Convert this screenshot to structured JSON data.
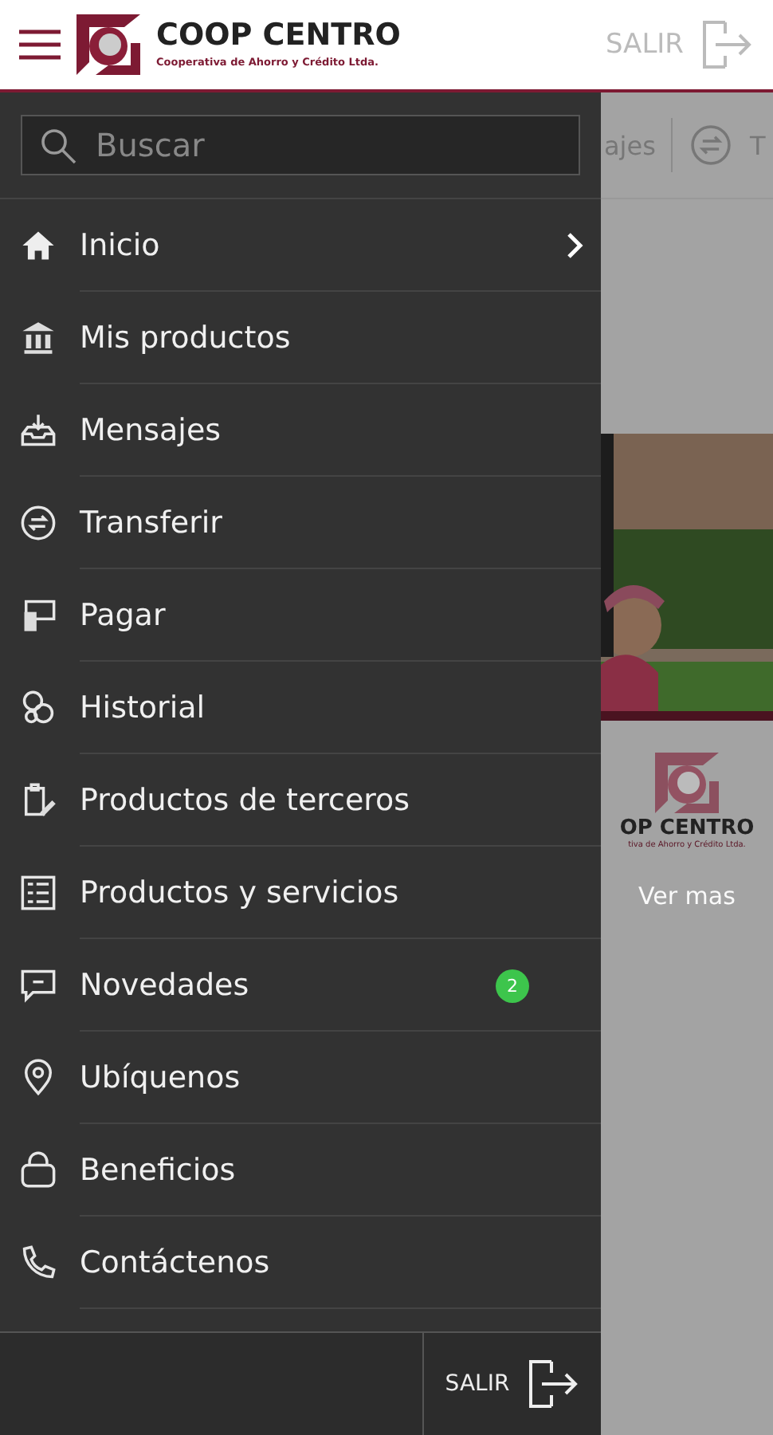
{
  "header": {
    "logo_title": "COOP CENTRO",
    "logo_subtitle": "Cooperativa de Ahorro y Crédito Ltda.",
    "logout": "SALIR"
  },
  "search": {
    "placeholder": "Buscar"
  },
  "menu": [
    {
      "label": "Inicio",
      "chevron": true
    },
    {
      "label": "Mis productos"
    },
    {
      "label": "Mensajes"
    },
    {
      "label": "Transferir"
    },
    {
      "label": "Pagar"
    },
    {
      "label": "Historial"
    },
    {
      "label": "Productos de terceros"
    },
    {
      "label": "Productos y servicios"
    },
    {
      "label": "Novedades",
      "badge": "2"
    },
    {
      "label": "Ubíquenos"
    },
    {
      "label": "Beneficios"
    },
    {
      "label": "Contáctenos"
    }
  ],
  "footer": {
    "logout": "SALIR"
  },
  "background": {
    "tabs": [
      "ajes",
      "T"
    ],
    "brand": "OP CENTRO",
    "brand_subtitle": "tiva de Ahorro y Crédito Ltda.",
    "link": "Ver mas"
  }
}
